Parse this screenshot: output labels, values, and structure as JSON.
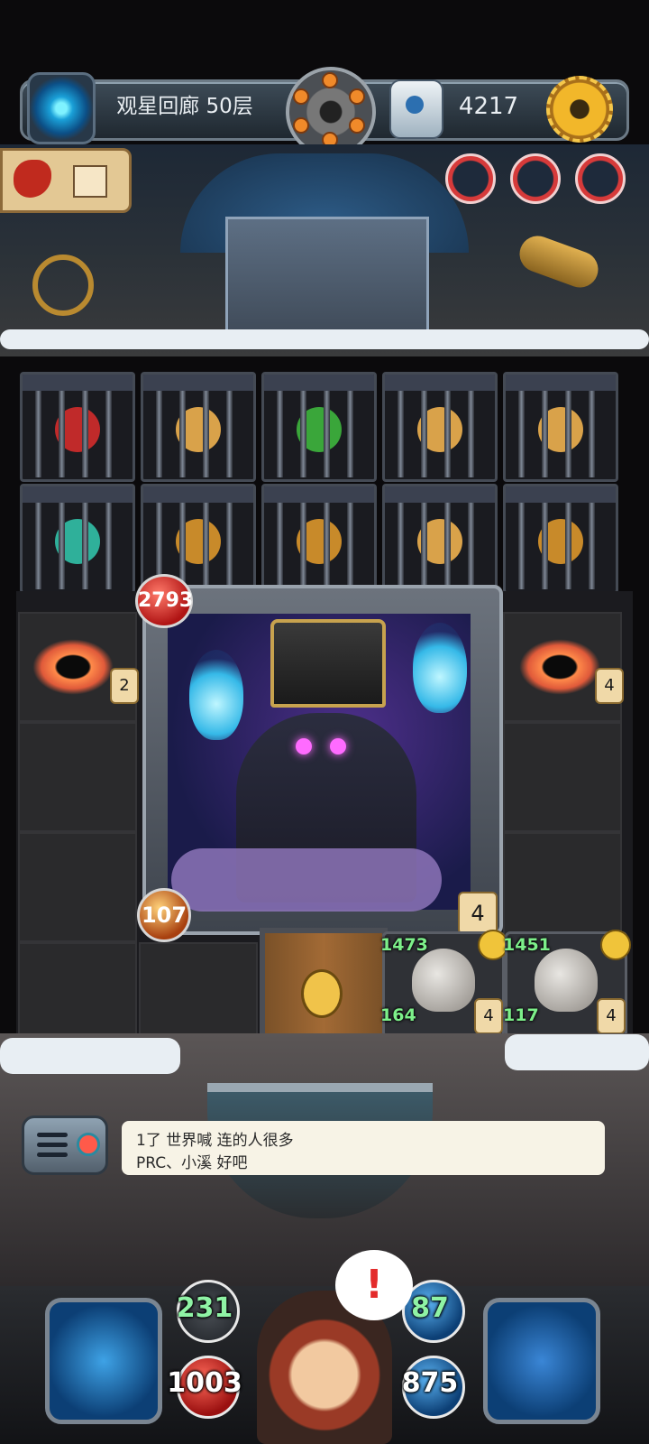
{
  "top_bar": {
    "portal_icon": "portal-icon",
    "floor_title": "观星回廊 50层",
    "revolver_icon": "revolver-icon",
    "key_icon": "key-icon",
    "key_count": "4217",
    "settings_icon": "gear-icon"
  },
  "map_button": {
    "icon": "map-icon"
  },
  "hero_badges": [
    "hero-badge-1",
    "hero-badge-2",
    "hero-badge-3"
  ],
  "cages": {
    "row1": [
      "caged-item-1",
      "caged-item-2",
      "caged-item-3",
      "caged-item-4",
      "caged-item-5"
    ],
    "row2": [
      "caged-item-6",
      "caged-item-7",
      "caged-item-8",
      "caged-item-9",
      "caged-item-10"
    ]
  },
  "board": {
    "left_blackhole_count": "2",
    "right_blackhole_count": "4",
    "boss": {
      "hp": "2793",
      "attack": "107",
      "timer": "4"
    },
    "ducks": [
      {
        "hp": "1473",
        "attack": "164",
        "turns": "4"
      },
      {
        "hp": "1451",
        "attack": "117",
        "turns": "4"
      }
    ]
  },
  "chat": {
    "line1": "1了  世界喊 连的人很多",
    "line2": "PRC、小溪  好吧"
  },
  "hud": {
    "attack": "231",
    "hp": "1003",
    "defense": "87",
    "mana": "875",
    "alert": "!"
  },
  "colors": {
    "accent_gold": "#f2b72a",
    "stat_green": "#8ff3a5",
    "chat_bg": "#f7f3e6"
  }
}
